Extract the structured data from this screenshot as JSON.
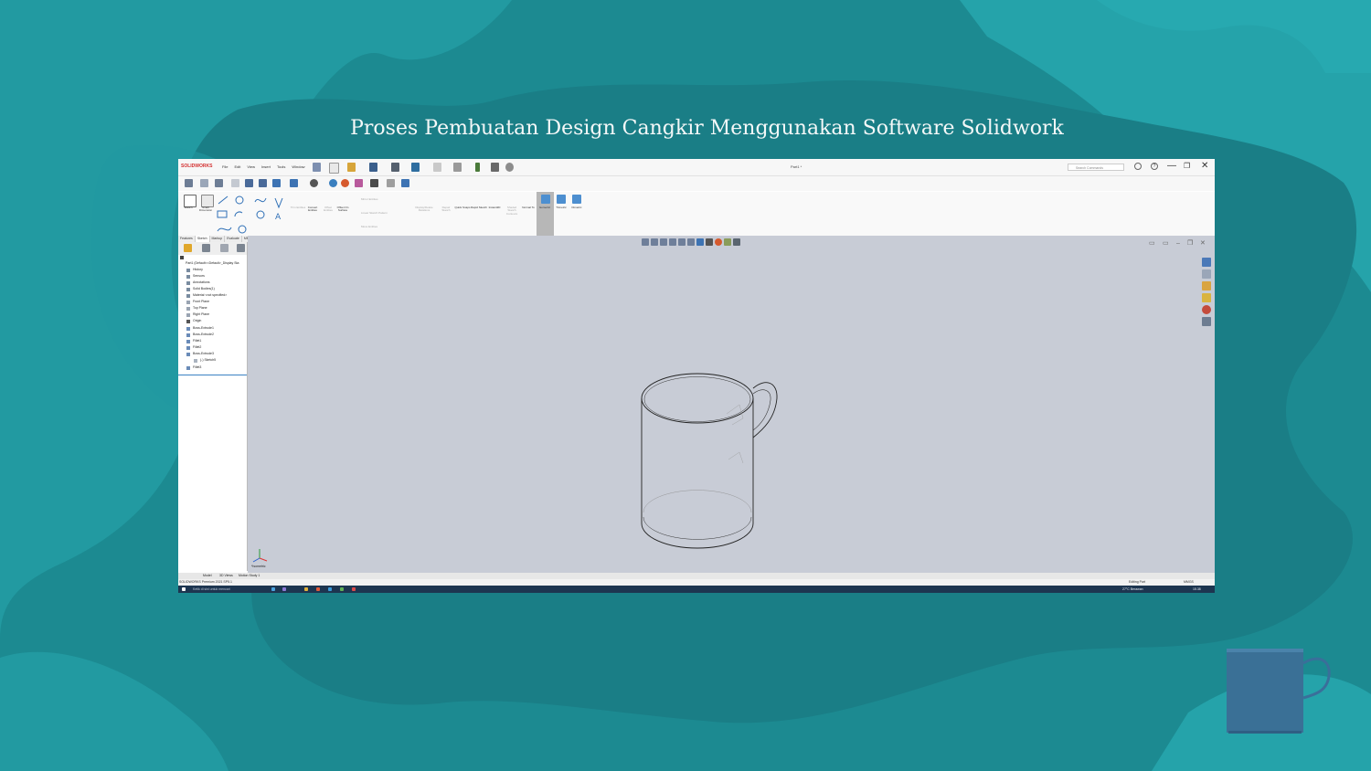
{
  "slide": {
    "title": "Proses Pembuatan Design Cangkir Menggunakan Software Solidwork"
  },
  "app": {
    "logo": "SOLIDWORKS",
    "menu": [
      "File",
      "Edit",
      "View",
      "Insert",
      "Tools",
      "Window"
    ],
    "document_title": "Part1 *",
    "search_placeholder": "Search Commands",
    "window_controls": {
      "minimize": "—",
      "restore": "❐",
      "close": "✕"
    }
  },
  "command_manager": {
    "sketch_tools": [
      "Sketch",
      "Smart Dimension"
    ],
    "group_buttons": [
      "Trim Entities",
      "Convert Entities",
      "Offset Entities",
      "Offset On Surface"
    ],
    "mirror_buttons": [
      "Mirror Entities",
      "Linear Sketch Pattern",
      "Move Entities"
    ],
    "right_buttons": [
      "Display/Delete Relations",
      "Repair Sketch",
      "Quick Snaps",
      "Rapid Sketch",
      "Instant2D",
      "Shaded Sketch Contours",
      "Normal To",
      "Isometric",
      "Trimetric",
      "Dimetric"
    ],
    "active_button": "Isometric"
  },
  "tabs": [
    "Features",
    "Sketch",
    "Markup",
    "Evaluate",
    "MBD Dimensions",
    "SOLIDWORKS Add-Ins",
    "MBD"
  ],
  "active_tab": "Sketch",
  "feature_tree": {
    "root": "Part1 (Default<<Default>_Display Sta",
    "items": [
      "History",
      "Sensors",
      "Annotations",
      "Solid Bodies(1)",
      "Material <not specified>",
      "Front Plane",
      "Top Plane",
      "Right Plane",
      "Origin",
      "Boss-Extrude1",
      "Boss-Extrude2",
      "Fillet1",
      "Fillet2",
      "Boss-Extrude3",
      "(-) Sketch5",
      "Fillet3"
    ]
  },
  "viewport": {
    "view_label": "*Isometric"
  },
  "bottom_tabs": [
    "Model",
    "3D Views",
    "Motion Study 1"
  ],
  "status": {
    "left": "SOLIDWORKS Premium 2021 SP5.1",
    "middle": "Editing Part",
    "right": "MMGS"
  },
  "taskbar": {
    "search": "Ketik di sini untuk mencari",
    "weather": "27°C  Berawan",
    "time": "15.38"
  },
  "colors": {
    "accent": "#d32f2f",
    "background": "#1f8d94",
    "viewport": "#c8ccd6",
    "taskbar": "#1d3550"
  }
}
